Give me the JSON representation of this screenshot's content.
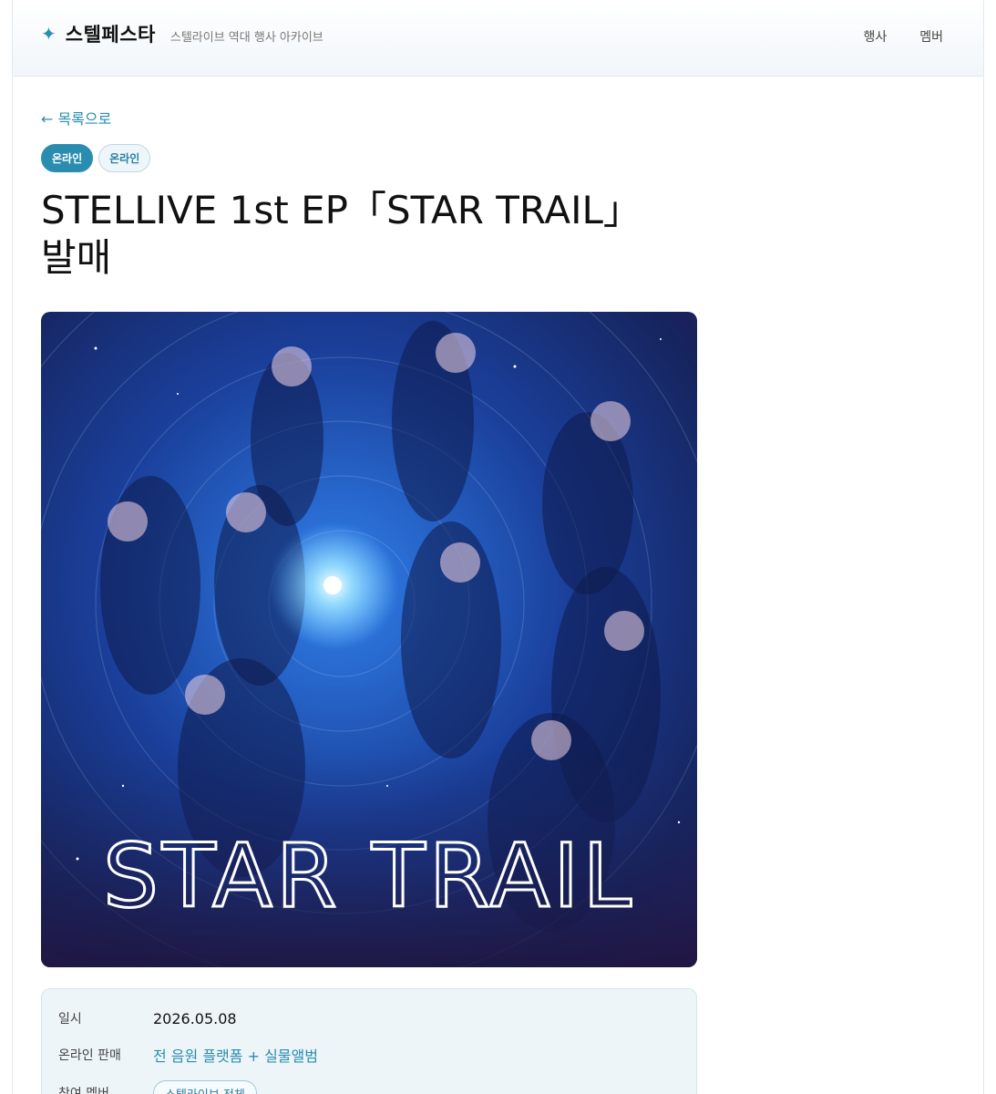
{
  "header": {
    "brand_icon": "sparkle-icon",
    "brand_name": "스텔페스타",
    "brand_subtitle": "스텔라이브 역대 행사 아카이브",
    "nav": [
      {
        "label": "행사"
      },
      {
        "label": "멤버"
      }
    ]
  },
  "back_link": "← 목록으로",
  "tags": [
    {
      "label": "온라인",
      "style": "primary"
    },
    {
      "label": "온라인",
      "style": "secondary"
    }
  ],
  "title_line1": "STELLIVE 1st EP「STAR TRAIL」",
  "title_line2": "발매",
  "cover": {
    "logo_text": "STAR TRAIL"
  },
  "info": {
    "rows": [
      {
        "label": "일시",
        "value": "2026.05.08"
      },
      {
        "label": "온라인 판매",
        "value": "전 음원 플랫폼 + 실물앨범"
      },
      {
        "label": "참여 멤버",
        "value": "스텔라이브 전체"
      }
    ]
  },
  "colors": {
    "accent": "#2a8db0",
    "tag_secondary_bg": "#eef6fa",
    "info_bg": "#eef5f9"
  }
}
